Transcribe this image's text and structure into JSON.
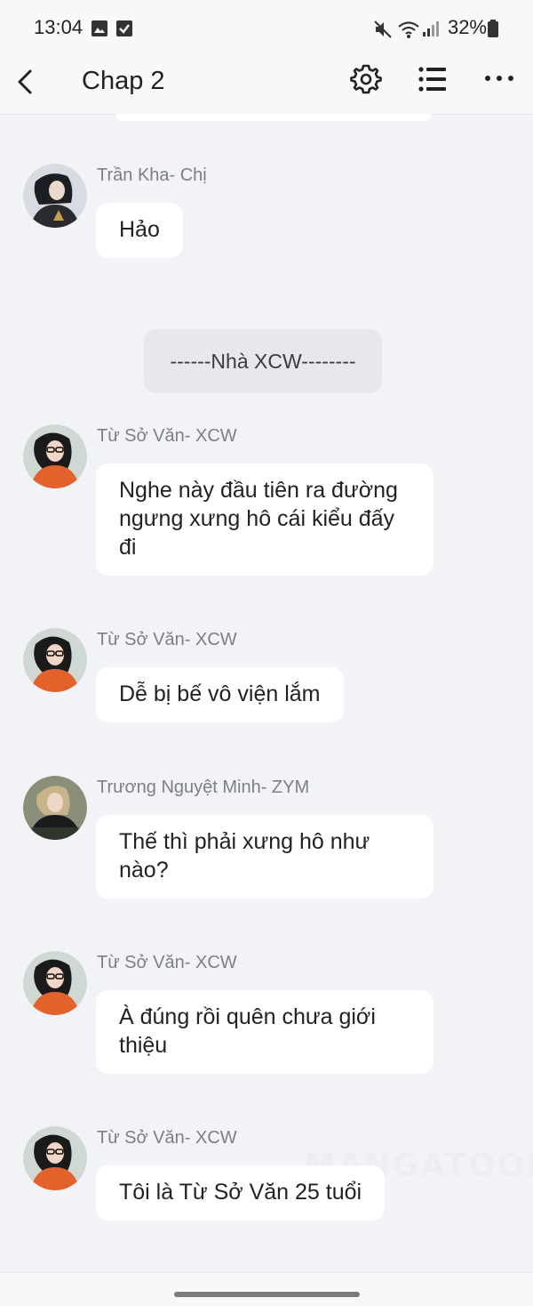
{
  "status_bar": {
    "time": "13:04",
    "battery": "32%",
    "icons": [
      "image-icon",
      "checkbox-icon",
      "mute-icon",
      "wifi-icon",
      "signal-icon",
      "battery-icon"
    ]
  },
  "header": {
    "title": "Chap 2",
    "icons": [
      "back-arrow-icon",
      "gear-icon",
      "list-icon",
      "more-dots-icon"
    ]
  },
  "messages": [
    {
      "sender": "Trần Kha- Chị",
      "text": "Hảo"
    },
    {
      "sender": "Từ Sở Văn- XCW",
      "text": "Nghe này đầu tiên ra đường ngưng xưng hô cái kiểu đấy đi"
    },
    {
      "sender": "Từ Sở Văn- XCW",
      "text": "Dễ bị bế vô viện lắm"
    },
    {
      "sender": "Trương Nguyệt Minh- ZYM",
      "text": "Thế thì phải xưng hô như nào?"
    },
    {
      "sender": "Từ Sở Văn- XCW",
      "text": "À đúng rồi quên chưa giới thiệu"
    },
    {
      "sender": "Từ Sở Văn- XCW",
      "text": "Tôi là Từ Sở Văn 25 tuổi"
    }
  ],
  "narration": "------Nhà XCW--------",
  "watermark": "MANGATOON",
  "colors": {
    "background": "#f2f3f6",
    "bubble": "#ffffff",
    "narration_bubble": "#e7e8eb",
    "sender_text": "#7d7f86"
  }
}
